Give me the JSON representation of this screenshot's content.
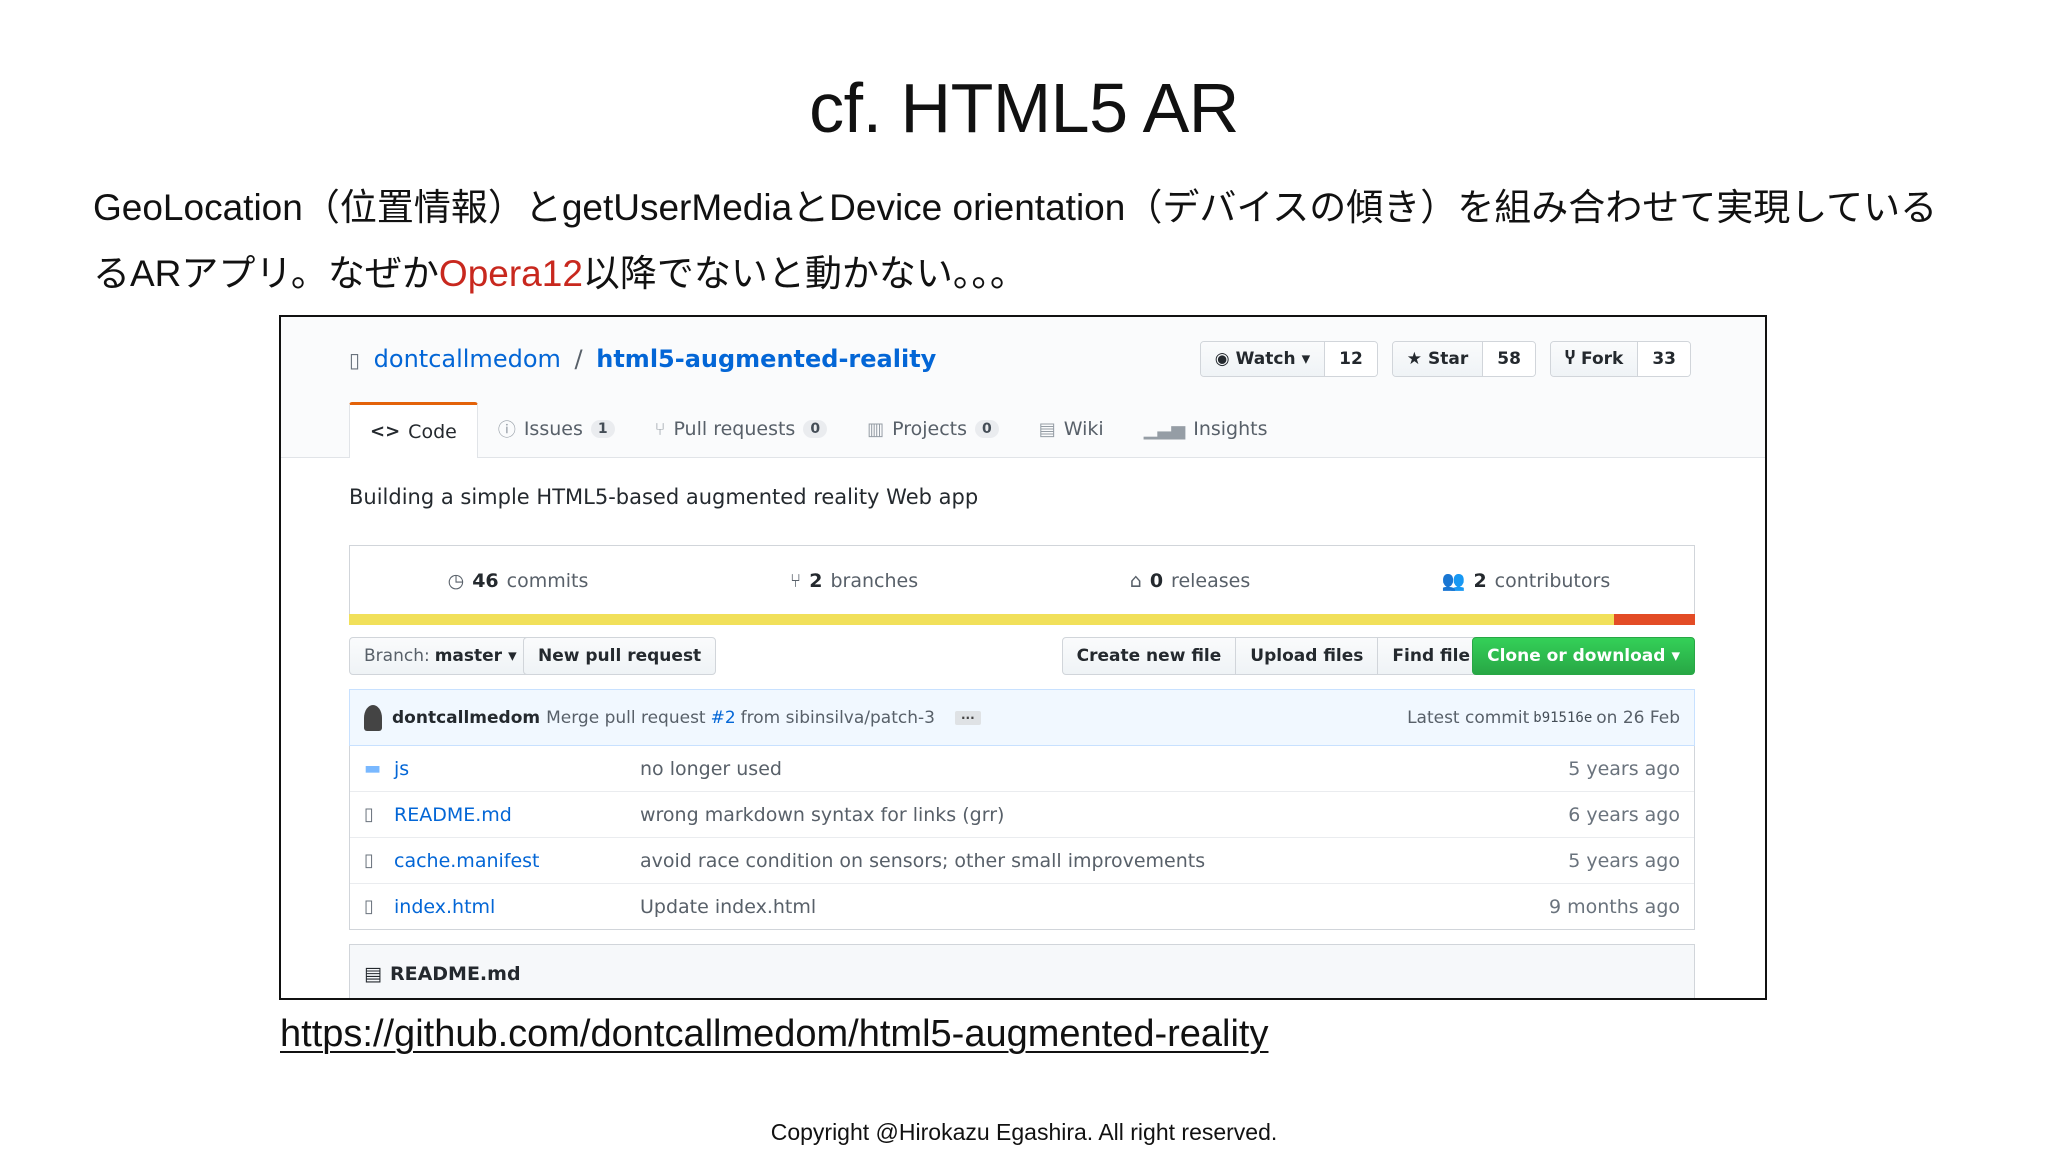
{
  "slide": {
    "title": "cf. HTML5 AR",
    "desc_part1": "GeoLocation（位置情報）とgetUserMediaとDevice orientation（デバイスの傾き）を組み合わせて実現している",
    "desc_part2": "るARアプリ。なぜか",
    "desc_highlight": "Opera12",
    "desc_part3": "以降でないと動かない。。。",
    "highlight_color": "#c8281e",
    "url": "https://github.com/dontcallmedom/html5-augmented-reality",
    "copyright": "Copyright @Hirokazu Egashira. All right reserved."
  },
  "repo": {
    "owner": "dontcallmedom",
    "separator": "/",
    "name": "html5-augmented-reality",
    "description": "Building a simple HTML5-based augmented reality Web app",
    "watch_label": "Watch",
    "watch_count": "12",
    "star_label": "Star",
    "star_count": "58",
    "fork_label": "Fork",
    "fork_count": "33"
  },
  "tabs": [
    {
      "label": "Code"
    },
    {
      "label": "Issues",
      "count": "1"
    },
    {
      "label": "Pull requests",
      "count": "0"
    },
    {
      "label": "Projects",
      "count": "0"
    },
    {
      "label": "Wiki"
    },
    {
      "label": "Insights"
    }
  ],
  "summary": {
    "commits_num": "46",
    "commits_label": "commits",
    "branches_num": "2",
    "branches_label": "branches",
    "releases_num": "0",
    "releases_label": "releases",
    "contributors_num": "2",
    "contributors_label": "contributors"
  },
  "languages": {
    "primary_color": "#f1e05a",
    "secondary_color": "#e34c26",
    "primary_share": 0.94
  },
  "toolbar": {
    "branch_prefix": "Branch:",
    "branch": "master",
    "new_pr": "New pull request",
    "create_file": "Create new file",
    "upload_files": "Upload files",
    "find_file": "Find file",
    "clone": "Clone or download"
  },
  "commit": {
    "author": "dontcallmedom",
    "msg_prefix": "Merge pull request",
    "pr": "#2",
    "msg_suffix": "from sibinsilva/patch-3",
    "ellipsis": "···",
    "latest_label": "Latest commit",
    "sha": "b91516e",
    "date": "on 26 Feb"
  },
  "files": [
    {
      "name": "js",
      "message": "no longer used",
      "age": "5 years ago",
      "type": "dir"
    },
    {
      "name": "README.md",
      "message": "wrong markdown syntax for links (grr)",
      "age": "6 years ago",
      "type": "file"
    },
    {
      "name": "cache.manifest",
      "message": "avoid race condition on sensors; other small improvements",
      "age": "5 years ago",
      "type": "file"
    },
    {
      "name": "index.html",
      "message": "Update index.html",
      "age": "9 months ago",
      "type": "file"
    }
  ],
  "readme": {
    "title": "README.md"
  }
}
